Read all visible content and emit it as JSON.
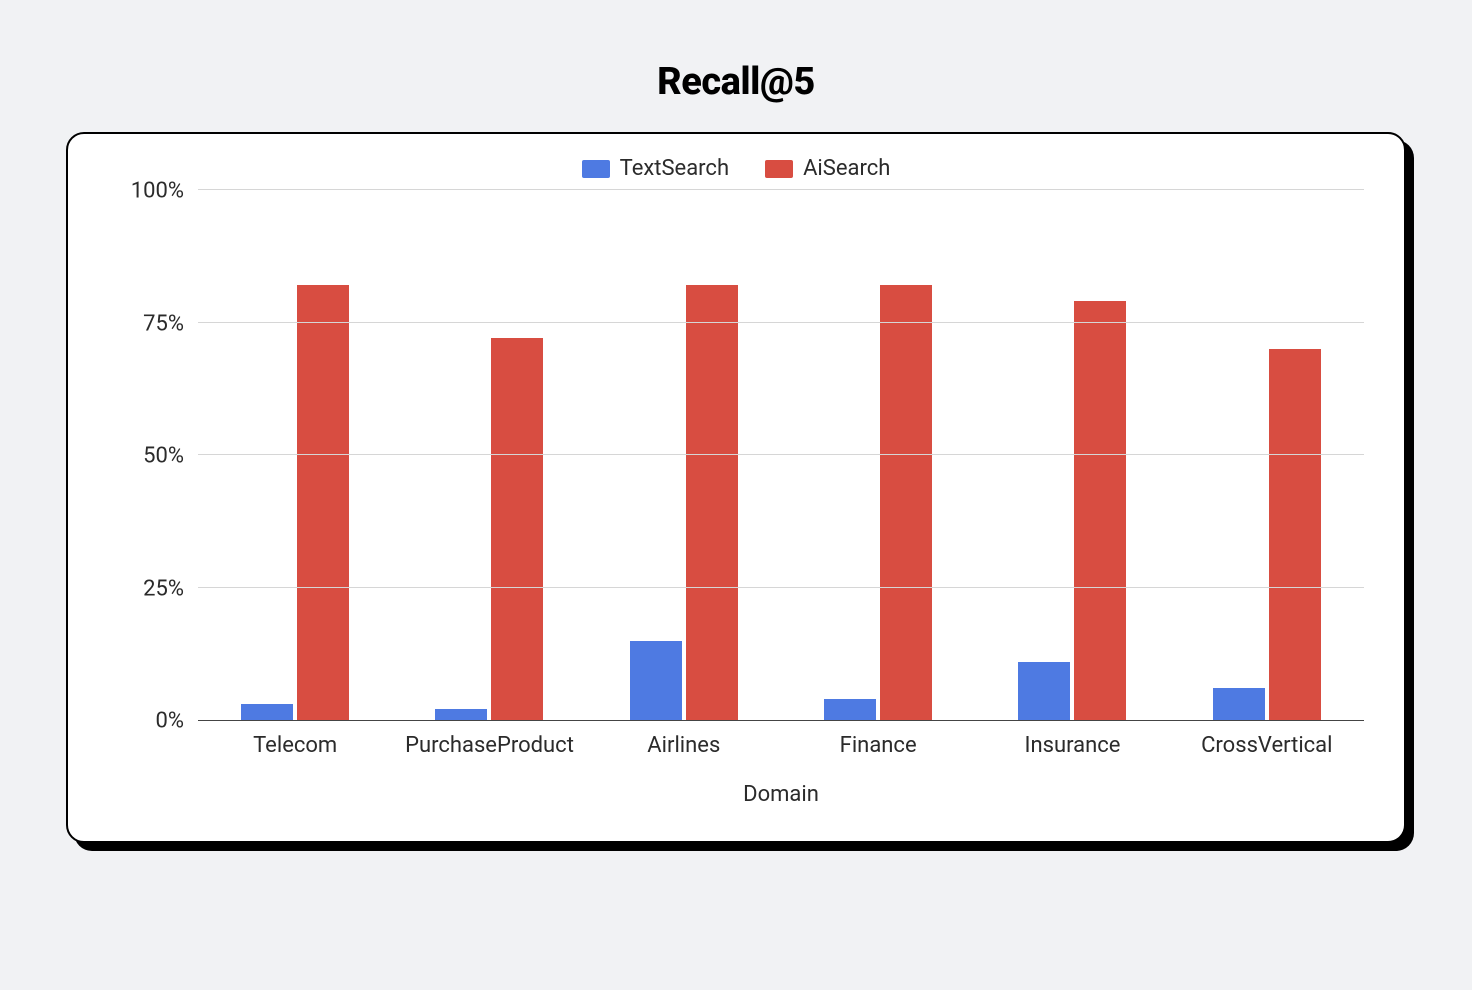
{
  "title": "Recall@5",
  "chart_data": {
    "type": "bar",
    "title": "Recall@5",
    "xlabel": "Domain",
    "ylabel": "",
    "ylim": [
      0,
      100
    ],
    "yticks": [
      0,
      25,
      50,
      75,
      100
    ],
    "ytick_labels": [
      "0%",
      "25%",
      "50%",
      "75%",
      "100%"
    ],
    "categories": [
      "Telecom",
      "PurchaseProduct",
      "Airlines",
      "Finance",
      "Insurance",
      "CrossVertical"
    ],
    "series": [
      {
        "name": "TextSearch",
        "color": "#4e7ae2",
        "values": [
          3,
          2,
          15,
          4,
          11,
          6
        ]
      },
      {
        "name": "AiSearch",
        "color": "#d84d41",
        "values": [
          82,
          72,
          82,
          82,
          79,
          70
        ]
      }
    ],
    "legend_position": "top",
    "grid": true
  }
}
